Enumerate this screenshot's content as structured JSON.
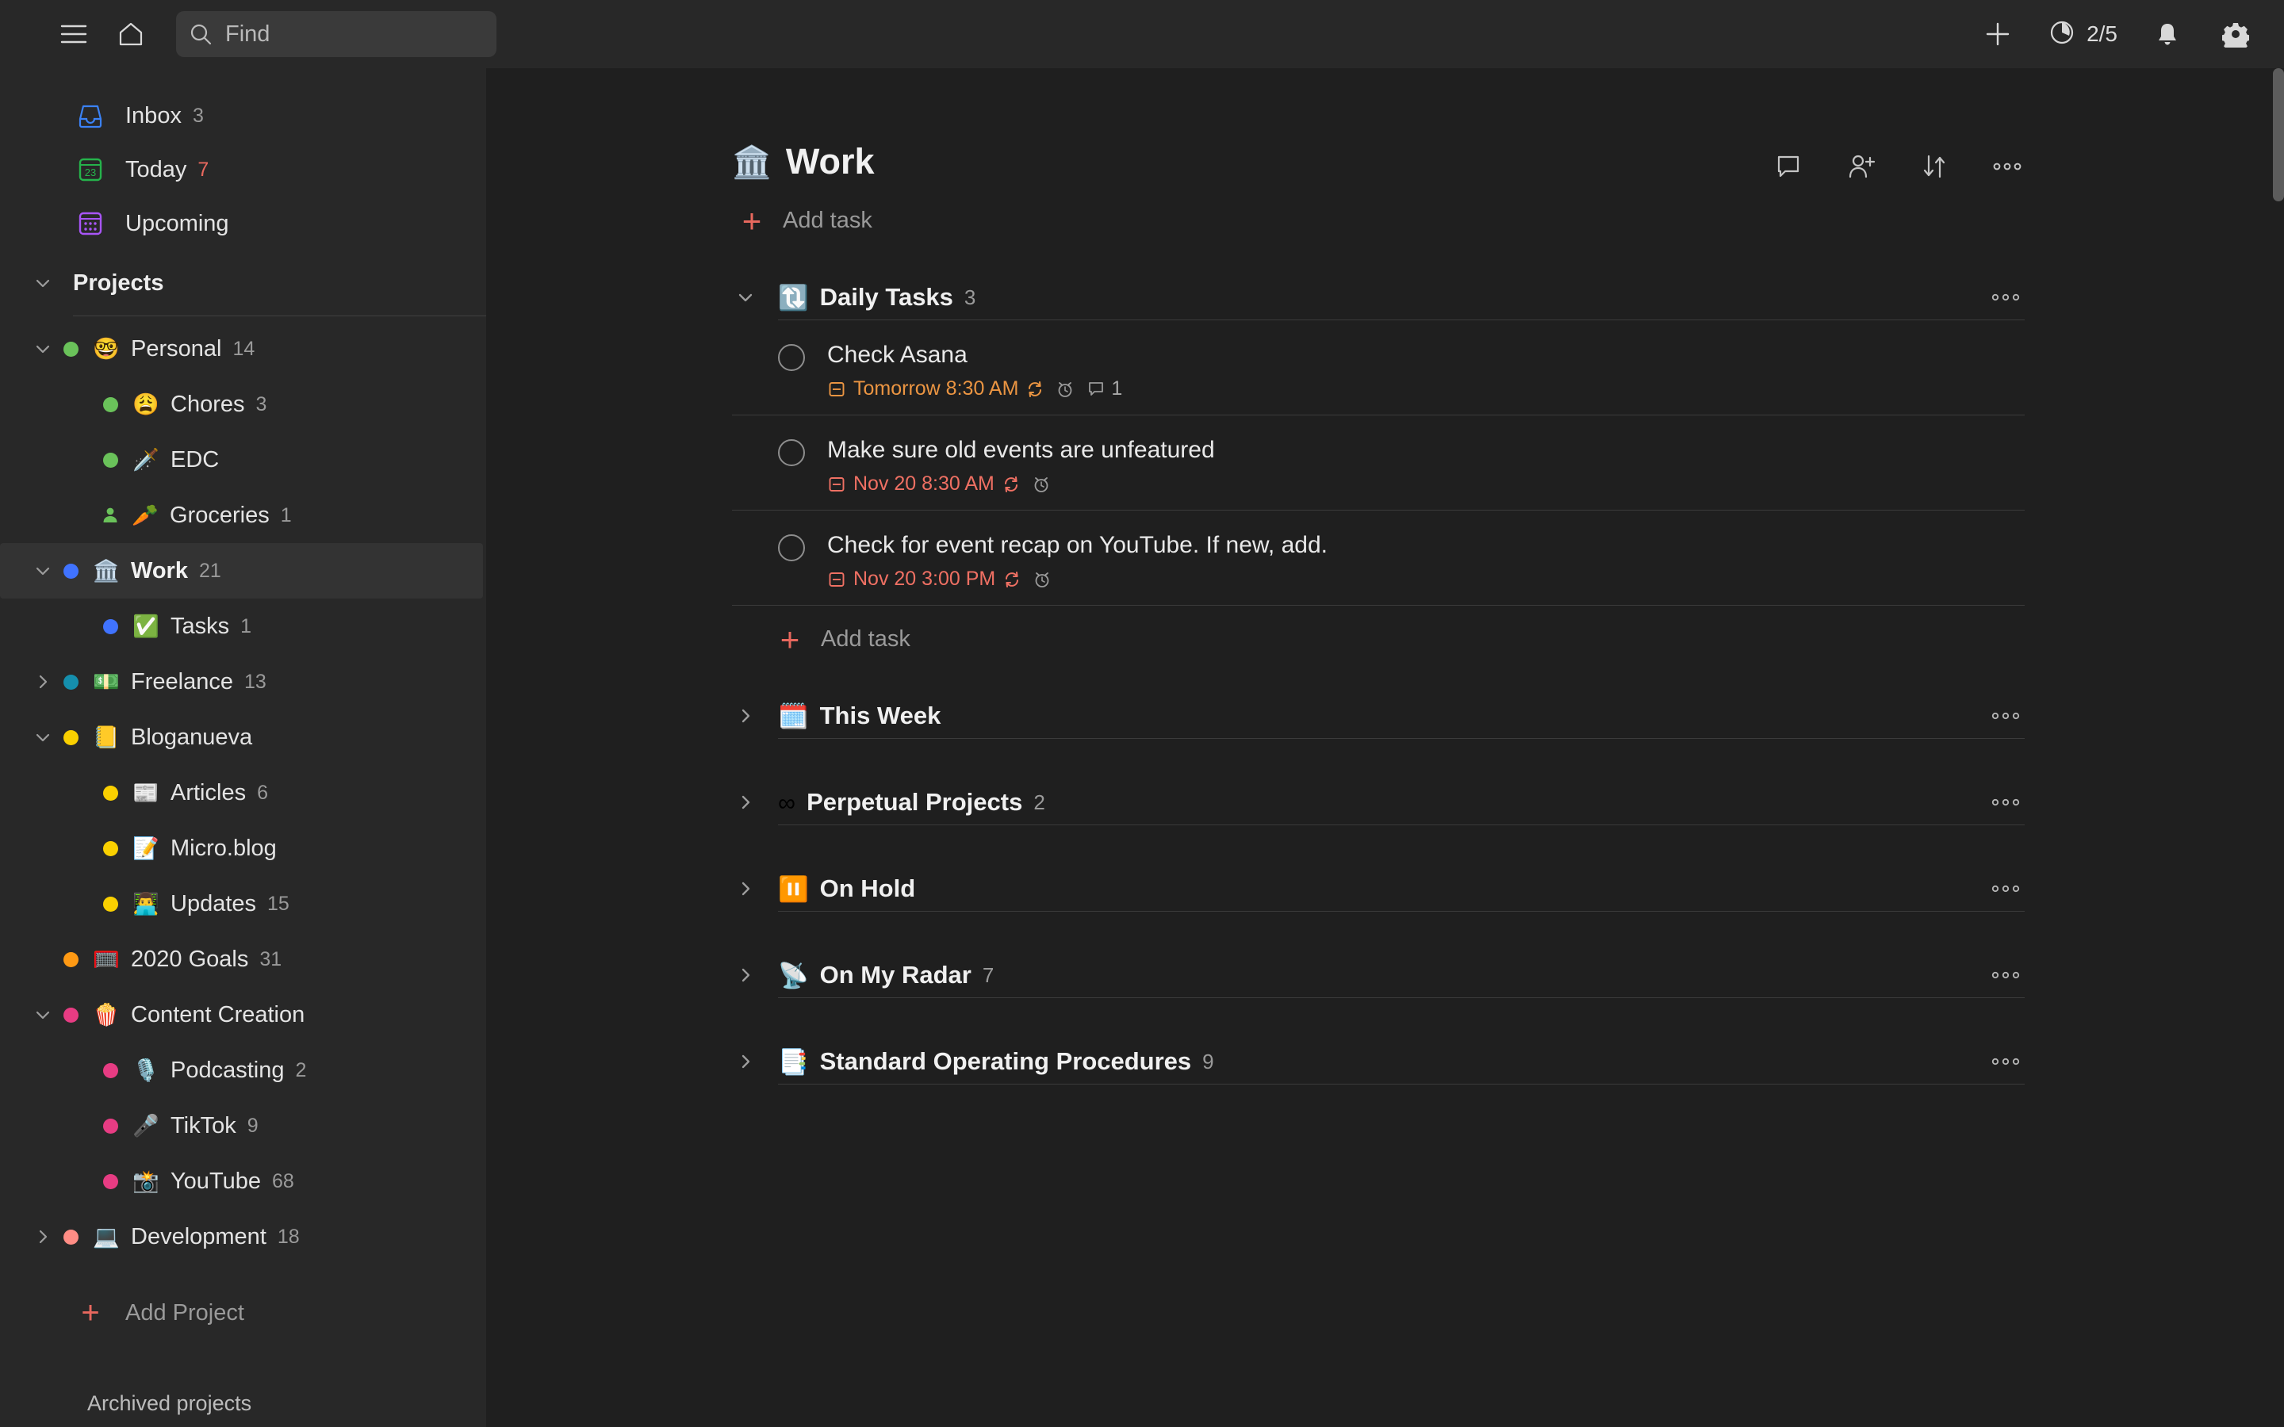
{
  "topbar": {
    "menu_icon": "hamburger-icon",
    "home_icon": "home-icon",
    "search": {
      "placeholder": "Find",
      "value": "",
      "icon": "search-icon"
    },
    "add_icon": "plus-icon",
    "karma": {
      "icon": "karma-progress-icon",
      "label": "2/5"
    },
    "notifications_icon": "bell-icon",
    "settings_icon": "gear-icon"
  },
  "sidebar": {
    "nav": [
      {
        "label": "Inbox",
        "count": "3",
        "icon": "inbox-icon",
        "count_style": "muted"
      },
      {
        "label": "Today",
        "count": "7",
        "icon": "calendar-today-icon",
        "count_style": "red"
      },
      {
        "label": "Upcoming",
        "count": "",
        "icon": "calendar-upcoming-icon",
        "count_style": "muted"
      }
    ],
    "projects_header": "Projects",
    "projects": [
      {
        "label": "Personal",
        "count": "14",
        "emoji": "🤓",
        "dot": "#6ac25a",
        "twist": "down",
        "level": 0,
        "active": false,
        "shared": false
      },
      {
        "label": "Chores",
        "count": "3",
        "emoji": "😩",
        "dot": "#6ac25a",
        "twist": "none",
        "level": 1,
        "active": false,
        "shared": false
      },
      {
        "label": "EDC",
        "count": "",
        "emoji": "🗡️",
        "dot": "#6ac25a",
        "twist": "none",
        "level": 1,
        "active": false,
        "shared": false
      },
      {
        "label": "Groceries",
        "count": "1",
        "emoji": "🥕",
        "dot": "#6ac25a",
        "twist": "none",
        "level": 1,
        "active": false,
        "shared": true
      },
      {
        "label": "Work",
        "count": "21",
        "emoji": "🏛️",
        "dot": "#4073ff",
        "twist": "down",
        "level": 0,
        "active": true,
        "shared": false
      },
      {
        "label": "Tasks",
        "count": "1",
        "emoji": "✅",
        "dot": "#4073ff",
        "twist": "none",
        "level": 1,
        "active": false,
        "shared": false
      },
      {
        "label": "Freelance",
        "count": "13",
        "emoji": "💵",
        "dot": "#158fad",
        "twist": "right",
        "level": 0,
        "active": false,
        "shared": false
      },
      {
        "label": "Bloganueva",
        "count": "",
        "emoji": "📒",
        "dot": "#fad000",
        "twist": "down",
        "level": 0,
        "active": false,
        "shared": false
      },
      {
        "label": "Articles",
        "count": "6",
        "emoji": "📰",
        "dot": "#fad000",
        "twist": "none",
        "level": 1,
        "active": false,
        "shared": false
      },
      {
        "label": "Micro.blog",
        "count": "",
        "emoji": "📝",
        "dot": "#fad000",
        "twist": "none",
        "level": 1,
        "active": false,
        "shared": false
      },
      {
        "label": "Updates",
        "count": "15",
        "emoji": "👨‍💻",
        "dot": "#fad000",
        "twist": "none",
        "level": 1,
        "active": false,
        "shared": false
      },
      {
        "label": "2020 Goals",
        "count": "31",
        "emoji": "🥅",
        "dot": "#ff9a14",
        "twist": "none",
        "level": 0,
        "active": false,
        "shared": false
      },
      {
        "label": "Content Creation",
        "count": "",
        "emoji": "🍿",
        "dot": "#e73c83",
        "twist": "down",
        "level": 0,
        "active": false,
        "shared": false
      },
      {
        "label": "Podcasting",
        "count": "2",
        "emoji": "🎙️",
        "dot": "#e73c83",
        "twist": "none",
        "level": 1,
        "active": false,
        "shared": false
      },
      {
        "label": "TikTok",
        "count": "9",
        "emoji": "🎤",
        "dot": "#e73c83",
        "twist": "none",
        "level": 1,
        "active": false,
        "shared": false
      },
      {
        "label": "YouTube",
        "count": "68",
        "emoji": "📸",
        "dot": "#e73c83",
        "twist": "none",
        "level": 1,
        "active": false,
        "shared": false
      },
      {
        "label": "Development",
        "count": "18",
        "emoji": "💻",
        "dot": "#ff8d85",
        "twist": "right",
        "level": 0,
        "active": false,
        "shared": false
      }
    ],
    "add_project": "Add Project",
    "archived_projects": "Archived projects"
  },
  "main": {
    "title": "Work",
    "title_emoji": "🏛️",
    "add_task_label": "Add task",
    "header_actions": [
      {
        "name": "comments-icon"
      },
      {
        "name": "add-person-icon"
      },
      {
        "name": "sort-icon"
      },
      {
        "name": "more-options-icon"
      }
    ],
    "sections": [
      {
        "name": "Daily Tasks",
        "count": "3",
        "emoji": "🔃",
        "expanded": true,
        "more_label": "●●●",
        "add_task_label": "Add task",
        "tasks": [
          {
            "title": "Check Asana",
            "due": "Tomorrow 8:30 AM",
            "due_state": "soon",
            "recurring": true,
            "reminder": true,
            "comments": "1"
          },
          {
            "title": "Make sure old events are unfeatured",
            "due": "Nov 20 8:30 AM",
            "due_state": "overdue",
            "recurring": true,
            "reminder": true,
            "comments": ""
          },
          {
            "title": "Check for event recap on YouTube. If new, add.",
            "due": "Nov 20 3:00 PM",
            "due_state": "overdue",
            "recurring": true,
            "reminder": true,
            "comments": ""
          }
        ]
      },
      {
        "name": "This Week",
        "count": "",
        "emoji": "🗓️",
        "expanded": false,
        "tasks": []
      },
      {
        "name": "Perpetual Projects",
        "count": "2",
        "emoji": "∞",
        "expanded": false,
        "tasks": []
      },
      {
        "name": "On Hold",
        "count": "",
        "emoji": "⏸️",
        "expanded": false,
        "tasks": []
      },
      {
        "name": "On My Radar",
        "count": "7",
        "emoji": "📡",
        "expanded": false,
        "tasks": []
      },
      {
        "name": "Standard Operating Procedures",
        "count": "9",
        "emoji": "📑",
        "expanded": false,
        "tasks": []
      }
    ]
  },
  "colors": {
    "accent_red": "#e8685e",
    "overdue": "#ef7063",
    "due_soon": "#eb9542",
    "sidebar_bg": "#282828",
    "main_bg": "#1f1f1f"
  }
}
